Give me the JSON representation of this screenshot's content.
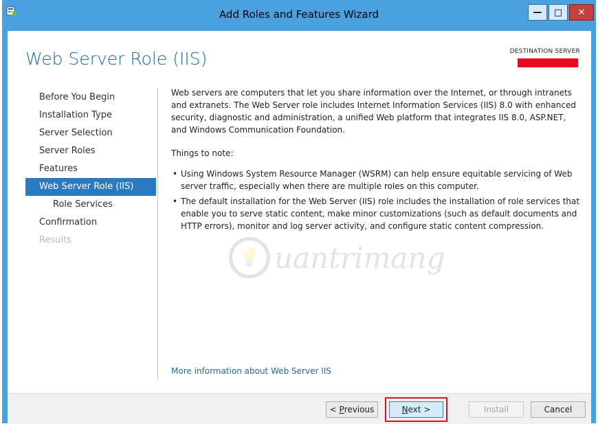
{
  "window": {
    "title": "Add Roles and Features Wizard",
    "controls": {
      "minimize": "—",
      "maximize": "□",
      "close": "✕"
    }
  },
  "page": {
    "title": "Web Server Role (IIS)",
    "destination_label": "DESTINATION SERVER"
  },
  "nav": {
    "items": [
      {
        "label": "Before You Begin",
        "state": "normal"
      },
      {
        "label": "Installation Type",
        "state": "normal"
      },
      {
        "label": "Server Selection",
        "state": "normal"
      },
      {
        "label": "Server Roles",
        "state": "normal"
      },
      {
        "label": "Features",
        "state": "normal"
      },
      {
        "label": "Web Server Role (IIS)",
        "state": "active"
      },
      {
        "label": "Role Services",
        "state": "sub"
      },
      {
        "label": "Confirmation",
        "state": "normal"
      },
      {
        "label": "Results",
        "state": "disabled"
      }
    ]
  },
  "content": {
    "intro": "Web servers are computers that let you share information over the Internet, or through intranets and extranets. The Web Server role includes Internet Information Services (IIS) 8.0 with enhanced security, diagnostic and administration, a unified Web platform that integrates IIS 8.0, ASP.NET, and Windows Communication Foundation.",
    "notes_heading": "Things to note:",
    "bullets": [
      "Using Windows System Resource Manager (WSRM) can help ensure equitable servicing of Web server traffic, especially when there are multiple roles on this computer.",
      "The default installation for the Web Server (IIS) role includes the installation of role services that enable you to serve static content, make minor customizations (such as default documents and HTTP errors), monitor and log server activity, and configure static content compression."
    ],
    "more_link": "More information about Web Server IIS"
  },
  "watermark": {
    "text": "uantrimang",
    "icon": "lightbulb-icon"
  },
  "footer": {
    "previous": {
      "prefix": "< ",
      "accel": "P",
      "rest": "revious"
    },
    "next": {
      "accel": "N",
      "rest": "ext >"
    },
    "install": "Install",
    "cancel": "Cancel"
  },
  "colors": {
    "titlebar": "#4aa1e0",
    "accent": "#2a7ac2",
    "highlight": "#e0101e"
  }
}
